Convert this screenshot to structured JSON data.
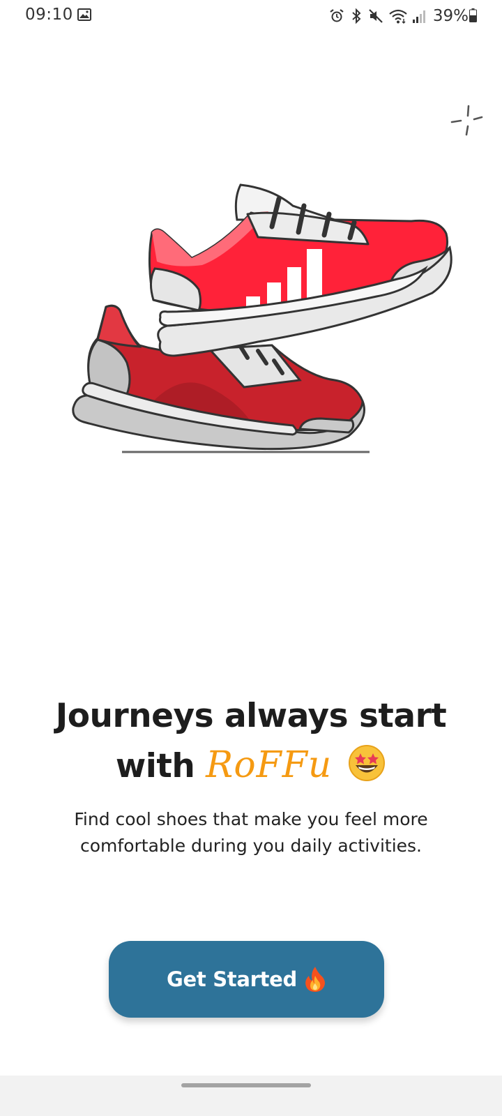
{
  "status_bar": {
    "time": "09:10",
    "battery_percent": "39%",
    "icons": [
      "gallery-icon",
      "alarm-icon",
      "bluetooth-icon",
      "mute-icon",
      "wifi-icon",
      "signal-icon",
      "battery-icon"
    ]
  },
  "illustration": {
    "icon": "sneakers-illustration",
    "colors": {
      "shoe_top": "#ff2239",
      "shoe_bottom": "#c8222c",
      "sole": "#e9e9e9",
      "outline": "#333333"
    }
  },
  "headline": {
    "line1": "Journeys always start",
    "line2_prefix": "with",
    "brand": "RoFFu",
    "emoji": "star-struck-emoji"
  },
  "subtitle": {
    "line1": "Find cool shoes that make you feel more",
    "line2": "comfortable during you daily activities."
  },
  "cta": {
    "label": "Get Started",
    "emoji": "fire-emoji",
    "color": "#2e7399"
  },
  "colors": {
    "brand": "#f59a12",
    "text": "#1d1d1d"
  }
}
